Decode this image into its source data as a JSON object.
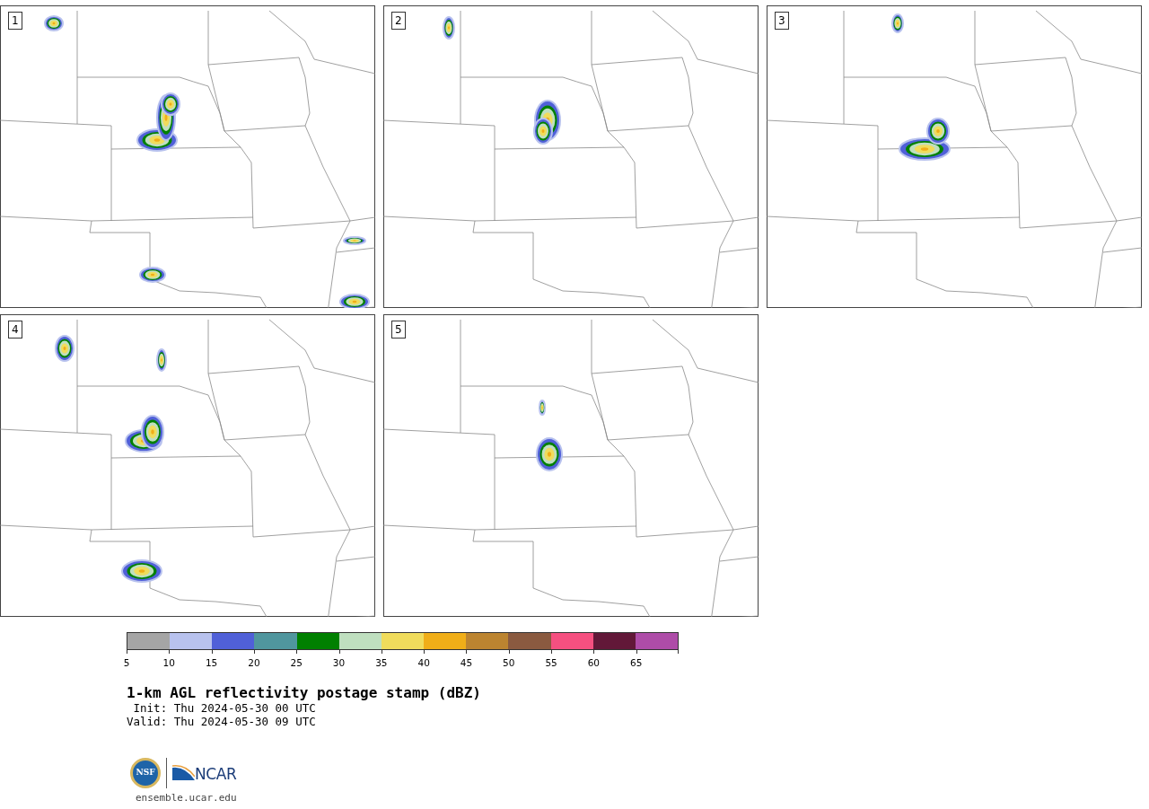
{
  "panels": [
    {
      "label": "1"
    },
    {
      "label": "2"
    },
    {
      "label": "3"
    },
    {
      "label": "4"
    },
    {
      "label": "5"
    }
  ],
  "colorbar": {
    "bins": [
      {
        "color": "#a5a5a5"
      },
      {
        "color": "#b8c2ee"
      },
      {
        "color": "#5060d8"
      },
      {
        "color": "#50969e"
      },
      {
        "color": "#008000"
      },
      {
        "color": "#bfdfbf"
      },
      {
        "color": "#f0dc5c"
      },
      {
        "color": "#f0ae18"
      },
      {
        "color": "#bc8430"
      },
      {
        "color": "#8a5a40"
      },
      {
        "color": "#f55080"
      },
      {
        "color": "#621838"
      },
      {
        "color": "#ae4ca8"
      }
    ],
    "tick_labels": [
      "5",
      "10",
      "15",
      "20",
      "25",
      "30",
      "35",
      "40",
      "45",
      "50",
      "55",
      "60",
      "65"
    ]
  },
  "title": "1-km AGL reflectivity postage stamp (dBZ)",
  "init": " Init: Thu 2024-05-30 00 UTC",
  "valid": "Valid: Thu 2024-05-30 09 UTC",
  "logos": {
    "nsf": "NSF",
    "ncar": "NCAR"
  },
  "footer": "ensemble.ucar.edu"
}
